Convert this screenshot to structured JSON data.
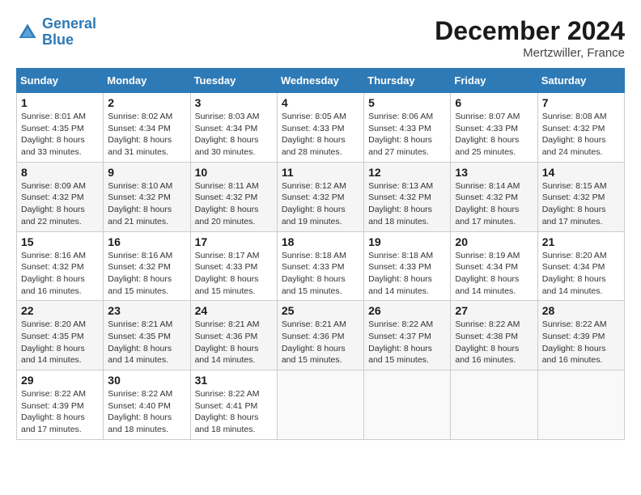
{
  "header": {
    "logo_line1": "General",
    "logo_line2": "Blue",
    "month_year": "December 2024",
    "location": "Mertzwiller, France"
  },
  "days_of_week": [
    "Sunday",
    "Monday",
    "Tuesday",
    "Wednesday",
    "Thursday",
    "Friday",
    "Saturday"
  ],
  "weeks": [
    [
      {
        "day": "1",
        "info": "Sunrise: 8:01 AM\nSunset: 4:35 PM\nDaylight: 8 hours\nand 33 minutes."
      },
      {
        "day": "2",
        "info": "Sunrise: 8:02 AM\nSunset: 4:34 PM\nDaylight: 8 hours\nand 31 minutes."
      },
      {
        "day": "3",
        "info": "Sunrise: 8:03 AM\nSunset: 4:34 PM\nDaylight: 8 hours\nand 30 minutes."
      },
      {
        "day": "4",
        "info": "Sunrise: 8:05 AM\nSunset: 4:33 PM\nDaylight: 8 hours\nand 28 minutes."
      },
      {
        "day": "5",
        "info": "Sunrise: 8:06 AM\nSunset: 4:33 PM\nDaylight: 8 hours\nand 27 minutes."
      },
      {
        "day": "6",
        "info": "Sunrise: 8:07 AM\nSunset: 4:33 PM\nDaylight: 8 hours\nand 25 minutes."
      },
      {
        "day": "7",
        "info": "Sunrise: 8:08 AM\nSunset: 4:32 PM\nDaylight: 8 hours\nand 24 minutes."
      }
    ],
    [
      {
        "day": "8",
        "info": "Sunrise: 8:09 AM\nSunset: 4:32 PM\nDaylight: 8 hours\nand 22 minutes."
      },
      {
        "day": "9",
        "info": "Sunrise: 8:10 AM\nSunset: 4:32 PM\nDaylight: 8 hours\nand 21 minutes."
      },
      {
        "day": "10",
        "info": "Sunrise: 8:11 AM\nSunset: 4:32 PM\nDaylight: 8 hours\nand 20 minutes."
      },
      {
        "day": "11",
        "info": "Sunrise: 8:12 AM\nSunset: 4:32 PM\nDaylight: 8 hours\nand 19 minutes."
      },
      {
        "day": "12",
        "info": "Sunrise: 8:13 AM\nSunset: 4:32 PM\nDaylight: 8 hours\nand 18 minutes."
      },
      {
        "day": "13",
        "info": "Sunrise: 8:14 AM\nSunset: 4:32 PM\nDaylight: 8 hours\nand 17 minutes."
      },
      {
        "day": "14",
        "info": "Sunrise: 8:15 AM\nSunset: 4:32 PM\nDaylight: 8 hours\nand 17 minutes."
      }
    ],
    [
      {
        "day": "15",
        "info": "Sunrise: 8:16 AM\nSunset: 4:32 PM\nDaylight: 8 hours\nand 16 minutes."
      },
      {
        "day": "16",
        "info": "Sunrise: 8:16 AM\nSunset: 4:32 PM\nDaylight: 8 hours\nand 15 minutes."
      },
      {
        "day": "17",
        "info": "Sunrise: 8:17 AM\nSunset: 4:33 PM\nDaylight: 8 hours\nand 15 minutes."
      },
      {
        "day": "18",
        "info": "Sunrise: 8:18 AM\nSunset: 4:33 PM\nDaylight: 8 hours\nand 15 minutes."
      },
      {
        "day": "19",
        "info": "Sunrise: 8:18 AM\nSunset: 4:33 PM\nDaylight: 8 hours\nand 14 minutes."
      },
      {
        "day": "20",
        "info": "Sunrise: 8:19 AM\nSunset: 4:34 PM\nDaylight: 8 hours\nand 14 minutes."
      },
      {
        "day": "21",
        "info": "Sunrise: 8:20 AM\nSunset: 4:34 PM\nDaylight: 8 hours\nand 14 minutes."
      }
    ],
    [
      {
        "day": "22",
        "info": "Sunrise: 8:20 AM\nSunset: 4:35 PM\nDaylight: 8 hours\nand 14 minutes."
      },
      {
        "day": "23",
        "info": "Sunrise: 8:21 AM\nSunset: 4:35 PM\nDaylight: 8 hours\nand 14 minutes."
      },
      {
        "day": "24",
        "info": "Sunrise: 8:21 AM\nSunset: 4:36 PM\nDaylight: 8 hours\nand 14 minutes."
      },
      {
        "day": "25",
        "info": "Sunrise: 8:21 AM\nSunset: 4:36 PM\nDaylight: 8 hours\nand 15 minutes."
      },
      {
        "day": "26",
        "info": "Sunrise: 8:22 AM\nSunset: 4:37 PM\nDaylight: 8 hours\nand 15 minutes."
      },
      {
        "day": "27",
        "info": "Sunrise: 8:22 AM\nSunset: 4:38 PM\nDaylight: 8 hours\nand 16 minutes."
      },
      {
        "day": "28",
        "info": "Sunrise: 8:22 AM\nSunset: 4:39 PM\nDaylight: 8 hours\nand 16 minutes."
      }
    ],
    [
      {
        "day": "29",
        "info": "Sunrise: 8:22 AM\nSunset: 4:39 PM\nDaylight: 8 hours\nand 17 minutes."
      },
      {
        "day": "30",
        "info": "Sunrise: 8:22 AM\nSunset: 4:40 PM\nDaylight: 8 hours\nand 18 minutes."
      },
      {
        "day": "31",
        "info": "Sunrise: 8:22 AM\nSunset: 4:41 PM\nDaylight: 8 hours\nand 18 minutes."
      },
      {
        "day": "",
        "info": ""
      },
      {
        "day": "",
        "info": ""
      },
      {
        "day": "",
        "info": ""
      },
      {
        "day": "",
        "info": ""
      }
    ]
  ]
}
